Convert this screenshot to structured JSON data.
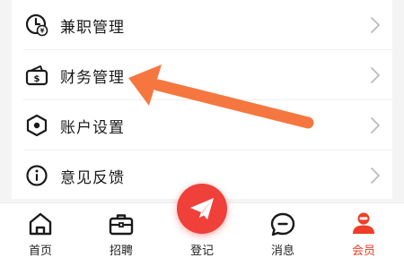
{
  "menu": {
    "items": [
      {
        "label": "兼职管理",
        "icon": "clock-yen-icon"
      },
      {
        "label": "财务管理",
        "icon": "wallet-icon"
      },
      {
        "label": "账户设置",
        "icon": "hexagon-settings-icon"
      },
      {
        "label": "意见反馈",
        "icon": "info-icon"
      }
    ]
  },
  "tabbar": {
    "tabs": [
      {
        "label": "首页",
        "icon": "home-icon"
      },
      {
        "label": "招聘",
        "icon": "briefcase-icon"
      },
      {
        "label": "登记",
        "icon": "paper-plane-icon"
      },
      {
        "label": "消息",
        "icon": "message-icon"
      },
      {
        "label": "会员",
        "icon": "member-icon",
        "active": true
      }
    ]
  },
  "colors": {
    "accent": "#f0403a",
    "annotation_arrow": "#f5773f",
    "active_tab": "#ee3e27"
  }
}
